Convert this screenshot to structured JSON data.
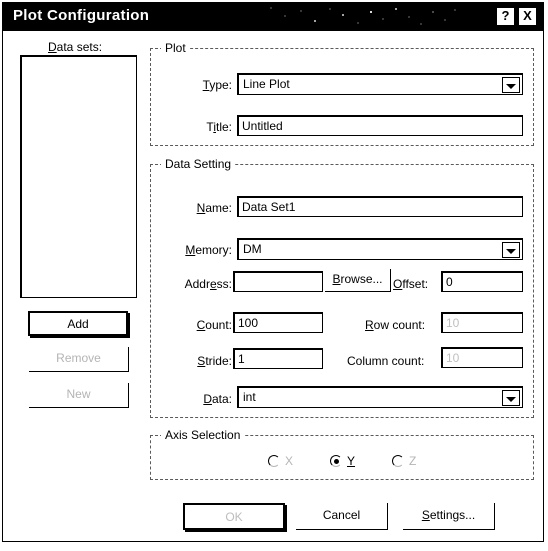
{
  "window": {
    "title": "Plot Configuration",
    "help_button": "?",
    "close_button": "X",
    "help_icon": "question-mark-icon",
    "close_icon": "close-x-icon"
  },
  "left_panel": {
    "datasets_label": "Data sets:",
    "datasets_label_accel": "D",
    "datasets_items": [],
    "buttons": [
      {
        "label": "Add",
        "accel": "A",
        "state": "default"
      },
      {
        "label": "Remove",
        "accel": "R",
        "state": "disabled"
      },
      {
        "label": "New",
        "accel": "N",
        "state": "disabled"
      }
    ]
  },
  "plot_group": {
    "legend": "Plot",
    "type_label": "Type:",
    "type_accel": "T",
    "type_value": "Line Plot",
    "type_options": [
      "Line Plot"
    ],
    "title_label": "Title:",
    "title_accel": "i",
    "title_value": "Untitled"
  },
  "data_setting_group": {
    "legend": "Data Setting",
    "name_label": "Name:",
    "name_accel": "N",
    "name_value": "Data Set1",
    "memory_label": "Memory:",
    "memory_accel": "M",
    "memory_value": "DM",
    "memory_options": [
      "DM"
    ],
    "address_label": "Address:",
    "address_accel": "e",
    "address_value": "",
    "browse_label": "Browse...",
    "browse_accel": "B",
    "offset_label": "Offset:",
    "offset_accel": "O",
    "offset_value": "0",
    "count_label": "Count:",
    "count_accel": "C",
    "count_value": "100",
    "row_count_label": "Row count:",
    "row_count_accel": "R",
    "row_count_value": "10",
    "row_count_state": "disabled",
    "stride_label": "Stride:",
    "stride_accel": "S",
    "stride_value": "1",
    "column_count_label": "Column count:",
    "column_count_value": "10",
    "column_count_state": "disabled",
    "data_label": "Data:",
    "data_accel": "D",
    "data_value": "int",
    "data_options": [
      "int"
    ]
  },
  "axis_group": {
    "legend": "Axis Selection",
    "radios": [
      {
        "label": "X",
        "selected": false,
        "state": "disabled"
      },
      {
        "label": "Y",
        "selected": true,
        "state": "enabled"
      },
      {
        "label": "Z",
        "selected": false,
        "state": "disabled"
      }
    ]
  },
  "footer": {
    "ok_label": "OK",
    "cancel_label": "Cancel",
    "settings_label": "Settings...",
    "settings_accel": "S"
  },
  "colors": {
    "titlebar_bg": "#000000",
    "titlebar_fg": "#ffffff",
    "dialog_bg": "#ffffff",
    "text": "#000000",
    "disabled_text": "#b4b4b4",
    "border": "#000000"
  }
}
